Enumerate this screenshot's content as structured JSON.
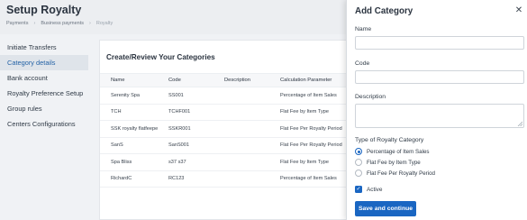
{
  "header": {
    "title": "Setup Royalty",
    "breadcrumb": [
      "Payments",
      "Business payments",
      "Royalty"
    ]
  },
  "sidebar": {
    "items": [
      {
        "label": "Initiate Transfers",
        "active": false
      },
      {
        "label": "Category details",
        "active": true
      },
      {
        "label": "Bank account",
        "active": false
      },
      {
        "label": "Royalty Preference Setup",
        "active": false
      },
      {
        "label": "Group rules",
        "active": false
      },
      {
        "label": "Centers Configurations",
        "active": false
      }
    ]
  },
  "main": {
    "title": "Create/Review Your Categories",
    "columns": [
      "Name",
      "Code",
      "Description",
      "Calculation Parameter"
    ],
    "rows": [
      {
        "name": "Serenity Spa",
        "code": "SS001",
        "description": "",
        "calc": "Percentage of Item Sales"
      },
      {
        "name": "TCH",
        "code": "TCHF001",
        "description": "",
        "calc": "Flat Fee by Item Type"
      },
      {
        "name": "SSK royalty flatfeepe",
        "code": "SSKR001",
        "description": "",
        "calc": "Flat Fee Per Royalty Period"
      },
      {
        "name": "SanS",
        "code": "SanS001",
        "description": "",
        "calc": "Flat Fee Per Royalty Period"
      },
      {
        "name": "Spa Bliss",
        "code": "s37 s37",
        "description": "",
        "calc": "Flat Fee by Item Type"
      },
      {
        "name": "RichardC",
        "code": "RC123",
        "description": "",
        "calc": "Percentage of Item Sales"
      }
    ]
  },
  "drawer": {
    "title": "Add Category",
    "name_label": "Name",
    "name_value": "",
    "code_label": "Code",
    "code_value": "",
    "description_label": "Description",
    "description_value": "",
    "type_label": "Type of Royalty Category",
    "type_options": [
      {
        "label": "Percentage of Item Sales",
        "selected": true
      },
      {
        "label": "Flat Fee by Item Type",
        "selected": false
      },
      {
        "label": "Flat Fee Per Royalty Period",
        "selected": false
      }
    ],
    "active_label": "Active",
    "active_checked": true,
    "submit_label": "Save and continue"
  },
  "colors": {
    "accent": "#1a66c2",
    "sidebar_active_bg": "#dfe4ea",
    "sidebar_active_text": "#2563a6"
  }
}
